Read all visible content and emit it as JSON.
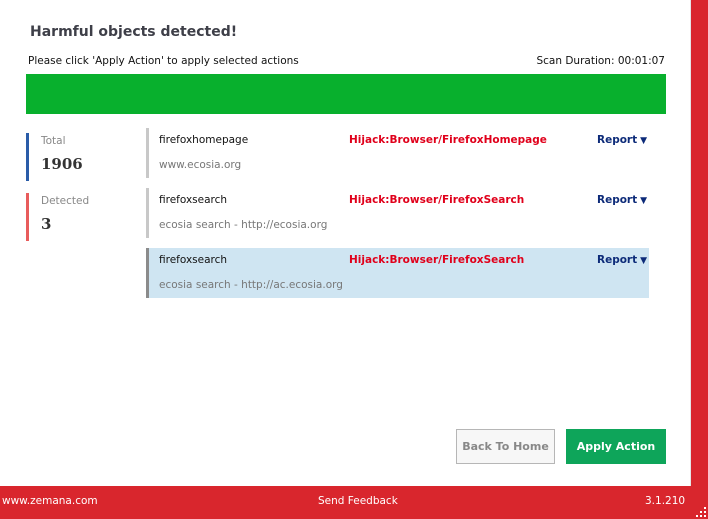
{
  "header": {
    "title": "Harmful objects detected!",
    "instruction": "Please click 'Apply Action' to apply selected actions",
    "scan_duration": "Scan Duration: 00:01:07"
  },
  "progress": {
    "percent": 100,
    "color": "#08b02d"
  },
  "stats": {
    "total_label": "Total",
    "total_value": "1906",
    "detected_label": "Detected",
    "detected_value": "3"
  },
  "threats": [
    {
      "name": "firefoxhomepage",
      "detail": "www.ecosia.org",
      "type": "Hijack:Browser/FirefoxHomepage",
      "report_label": "Report",
      "selected": false
    },
    {
      "name": "firefoxsearch",
      "detail": "ecosia search - http://ecosia.org",
      "type": "Hijack:Browser/FirefoxSearch",
      "report_label": "Report",
      "selected": false
    },
    {
      "name": "firefoxsearch",
      "detail": "ecosia search - http://ac.ecosia.org",
      "type": "Hijack:Browser/FirefoxSearch",
      "report_label": "Report",
      "selected": true
    }
  ],
  "buttons": {
    "back_home": "Back To Home",
    "apply_action": "Apply Action"
  },
  "footer": {
    "website": "www.zemana.com",
    "feedback": "Send Feedback",
    "version": "3.1.210"
  },
  "icons": {
    "report_caret": "triangle-down",
    "resize_grip": "resize-grip"
  },
  "colors": {
    "brand_red": "#d9262d",
    "threat_red": "#e0001b",
    "apply_green": "#0ea55a",
    "selected_row": "#cfe5f2"
  }
}
